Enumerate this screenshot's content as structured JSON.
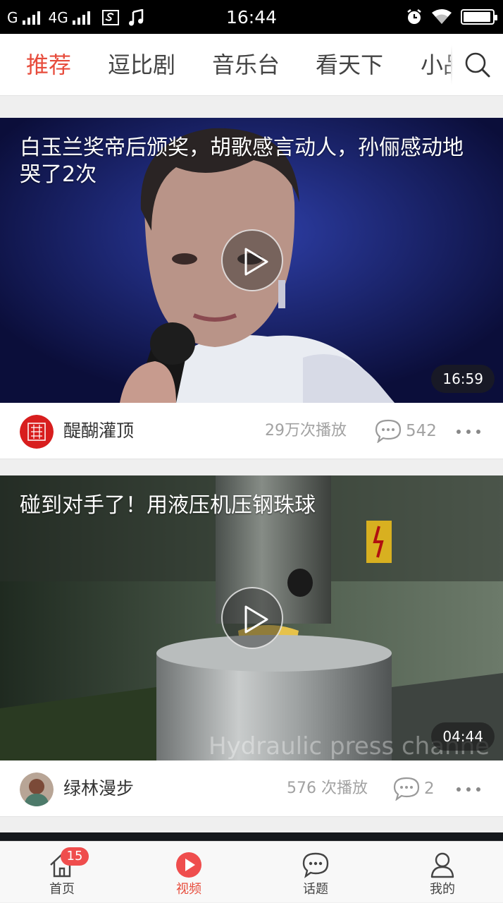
{
  "status_bar": {
    "carrier1": "G",
    "carrier2": "4G",
    "time": "16:44",
    "icons": [
      "signal-icon",
      "screenshot-icon",
      "music-icon",
      "alarm-icon",
      "wifi-icon",
      "battery-icon"
    ],
    "battery_level": 0.95
  },
  "tabs": {
    "items": [
      {
        "label": "推荐",
        "active": true
      },
      {
        "label": "逗比剧",
        "active": false
      },
      {
        "label": "音乐台",
        "active": false
      },
      {
        "label": "看天下",
        "active": false
      },
      {
        "label": "小品",
        "active": false
      }
    ],
    "search_icon": "search-icon",
    "active_color": "#e74c3c"
  },
  "videos": [
    {
      "title": "白玉兰奖帝后颁奖，胡歌感言动人，孙俪感动地哭了2次",
      "duration": "16:59",
      "author": "醍醐灌顶",
      "plays": "29万次播放",
      "comments": "542"
    },
    {
      "title": "碰到对手了！用液压机压钢珠球",
      "duration": "04:44",
      "author": "绿林漫步",
      "plays": "576 次播放",
      "comments": "2",
      "thumb_watermark": "Hydraulic press channe"
    }
  ],
  "bottom_nav": {
    "items": [
      {
        "label": "首页",
        "icon": "home-icon",
        "badge": "15"
      },
      {
        "label": "视频",
        "icon": "video-icon",
        "active": true
      },
      {
        "label": "话题",
        "icon": "chat-icon"
      },
      {
        "label": "我的",
        "icon": "user-icon"
      }
    ]
  }
}
